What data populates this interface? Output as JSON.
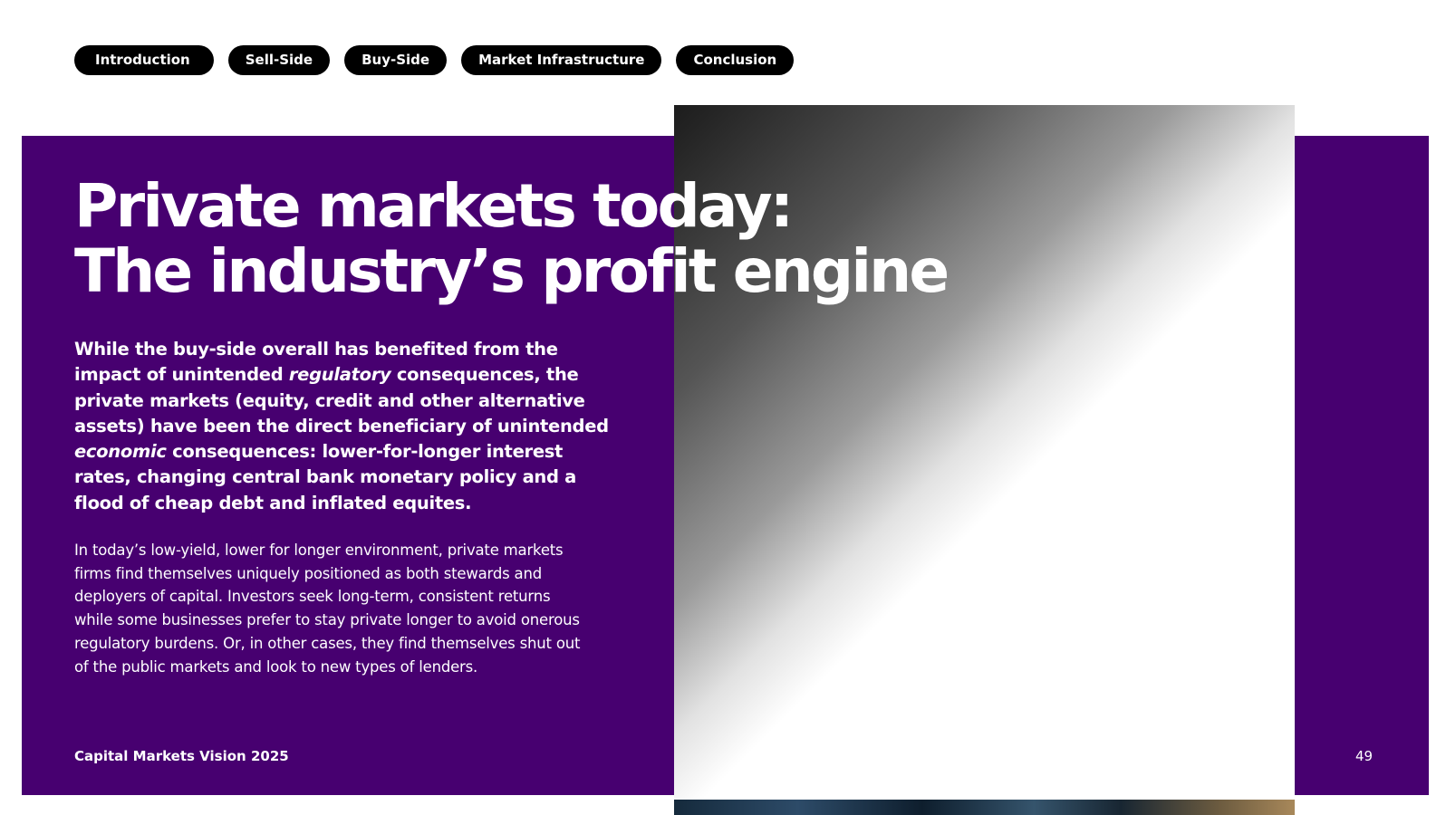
{
  "nav": {
    "items": [
      {
        "label": "Introduction"
      },
      {
        "label": "Sell-Side"
      },
      {
        "label": "Buy-Side"
      },
      {
        "label": "Market Infrastructure"
      },
      {
        "label": "Conclusion"
      }
    ]
  },
  "colors": {
    "panel": "#470070",
    "pill_bg": "#000000",
    "text": "#ffffff"
  },
  "title": {
    "line1": "Private markets today:",
    "line2": "The industry’s profit engine"
  },
  "lead": {
    "part1": "While the buy-side overall has benefited from the impact of unintended ",
    "em1": "regulatory",
    "part2": " consequences, the private markets (equity, credit and other alternative assets) have been the direct beneficiary of unintended ",
    "em2": "economic",
    "part3": " consequences: lower-for-longer interest rates, changing central bank monetary policy and a flood of cheap debt and inflated equites."
  },
  "body_text": "In today’s low-yield, lower for longer environment, private markets firms find themselves uniquely positioned as both stewards and deployers of capital. Investors seek long-term, consistent returns while some businesses prefer to stay private longer to avoid onerous regulatory burdens. Or, in other cases, they find themselves shut out of the public markets and look to new types of lenders.",
  "footer": {
    "publication": "Capital Markets Vision 2025",
    "page_number": "49"
  }
}
